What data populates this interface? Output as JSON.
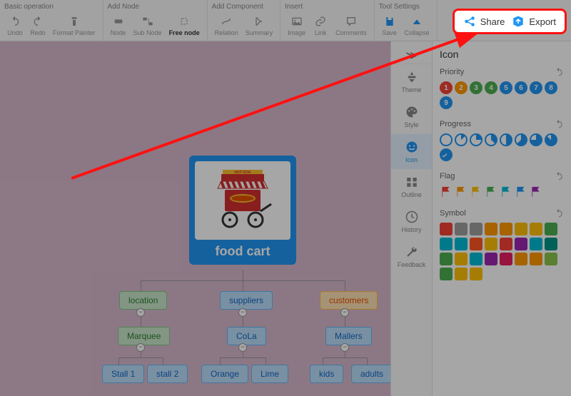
{
  "toolbar": {
    "groups": [
      {
        "title": "Basic operation",
        "items": [
          {
            "name": "undo",
            "label": "Undo"
          },
          {
            "name": "redo",
            "label": "Redo"
          },
          {
            "name": "format-painter",
            "label": "Format Painter"
          }
        ]
      },
      {
        "title": "Add Node",
        "items": [
          {
            "name": "node",
            "label": "Node"
          },
          {
            "name": "sub-node",
            "label": "Sub Node"
          },
          {
            "name": "free-node",
            "label": "Free node",
            "active": true
          }
        ]
      },
      {
        "title": "Add Component",
        "items": [
          {
            "name": "relation",
            "label": "Relation"
          },
          {
            "name": "summary",
            "label": "Summary"
          }
        ]
      },
      {
        "title": "Insert",
        "items": [
          {
            "name": "image",
            "label": "Image"
          },
          {
            "name": "link",
            "label": "Link"
          },
          {
            "name": "comments",
            "label": "Comments"
          }
        ]
      },
      {
        "title": "Tool Settings",
        "items": [
          {
            "name": "save",
            "label": "Save"
          },
          {
            "name": "collapse",
            "label": "Collapse"
          }
        ]
      }
    ],
    "share": "Share",
    "export": "Export"
  },
  "mindmap": {
    "root": "food cart",
    "hotdog_sign": "HOT DOG",
    "level1": [
      {
        "label": "location",
        "color": "green",
        "children": [
          {
            "label": "Marquee",
            "color": "green",
            "children": [
              {
                "label": "Stall 1",
                "color": "blue"
              },
              {
                "label": "stall 2",
                "color": "blue"
              }
            ]
          }
        ]
      },
      {
        "label": "suppliers",
        "color": "blue",
        "children": [
          {
            "label": "CoLa",
            "color": "blue",
            "children": [
              {
                "label": "Orange",
                "color": "blue"
              },
              {
                "label": "Lime",
                "color": "blue"
              }
            ]
          }
        ]
      },
      {
        "label": "customers",
        "color": "orange",
        "children": [
          {
            "label": "Mallers",
            "color": "blue",
            "children": [
              {
                "label": "kids",
                "color": "blue"
              },
              {
                "label": "adults",
                "color": "blue"
              }
            ]
          }
        ]
      }
    ]
  },
  "side_tabs": [
    {
      "name": "theme",
      "label": "Theme"
    },
    {
      "name": "style",
      "label": "Style"
    },
    {
      "name": "icon",
      "label": "Icon",
      "active": true
    },
    {
      "name": "outline",
      "label": "Outline"
    },
    {
      "name": "history",
      "label": "History"
    },
    {
      "name": "feedback",
      "label": "Feedback"
    }
  ],
  "panel": {
    "title": "Icon",
    "sections": {
      "priority": {
        "title": "Priority",
        "colors": [
          "#f44336",
          "#ff9800",
          "#4caf50",
          "#4caf50",
          "#2196f3",
          "#2196f3",
          "#2196f3",
          "#2196f3",
          "#2196f3"
        ]
      },
      "progress": {
        "title": "Progress",
        "count": 9
      },
      "flag": {
        "title": "Flag",
        "colors": [
          "#f44336",
          "#ff9800",
          "#ffc107",
          "#4caf50",
          "#00bcd4",
          "#2196f3",
          "#9c27b0"
        ]
      },
      "symbol": {
        "title": "Symbol",
        "colors": [
          "#f44336",
          "#9e9e9e",
          "#9e9e9e",
          "#ff9800",
          "#ff9800",
          "#ffc107",
          "#ffc107",
          "#4caf50",
          "#00bcd4",
          "#00bcd4",
          "#ff5722",
          "#ffc107",
          "#f44336",
          "#9c27b0",
          "#00bcd4",
          "#009688",
          "#4caf50",
          "#ffc107",
          "#00bcd4",
          "#9c27b0",
          "#e91e63",
          "#ff9800",
          "#ff9800",
          "#8bc34a",
          "#4caf50",
          "#ffc107",
          "#ffc107"
        ]
      }
    }
  }
}
